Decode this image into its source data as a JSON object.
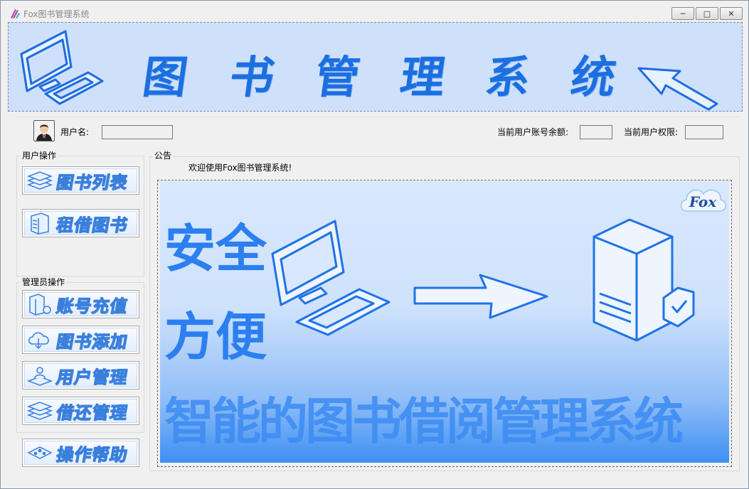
{
  "window": {
    "title": "Fox图书管理系统",
    "controls": {
      "minimize": "─",
      "maximize": "□",
      "close": "✕"
    }
  },
  "banner": {
    "title_chars": [
      "图",
      "书",
      "管",
      "理",
      "系",
      "统"
    ],
    "icons": [
      "computer-icon",
      "arrow-icon"
    ]
  },
  "user_bar": {
    "username_label": "用户名:",
    "username_value": "",
    "balance_label": "当前用户账号余额:",
    "balance_value": "",
    "permission_label": "当前用户权限:",
    "permission_value": ""
  },
  "user_ops": {
    "title": "用户操作",
    "buttons": [
      {
        "label": "图书列表",
        "icon": "book-stack-icon"
      },
      {
        "label": "租借图书",
        "icon": "book-shelf-icon"
      }
    ]
  },
  "admin_ops": {
    "title": "管理员操作",
    "buttons": [
      {
        "label": "账号充值",
        "icon": "recharge-icon"
      },
      {
        "label": "图书添加",
        "icon": "add-book-icon"
      },
      {
        "label": "用户管理",
        "icon": "user-manage-icon"
      },
      {
        "label": "借还管理",
        "icon": "borrow-return-icon"
      }
    ],
    "help_button": {
      "label": "操作帮助",
      "icon": "help-icon"
    }
  },
  "notice": {
    "title": "公告",
    "text": "欢迎使用Fox图书管理系统!"
  },
  "poster": {
    "line1": "安全",
    "line2": "方便",
    "slogan": "智能的图书借阅管理系统",
    "badge": "Fox"
  }
}
